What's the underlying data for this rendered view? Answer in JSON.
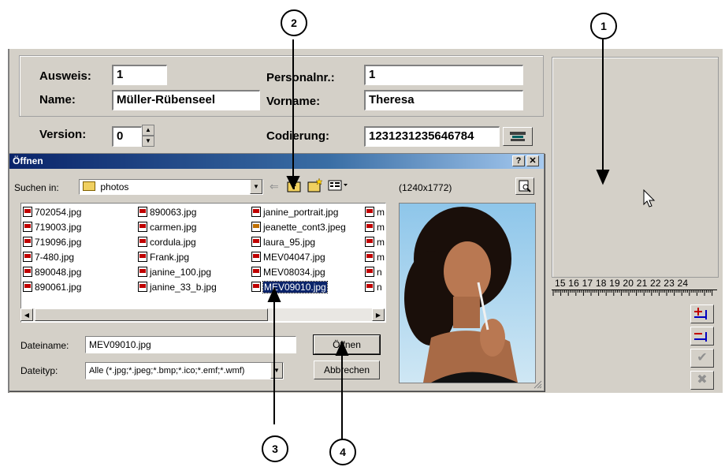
{
  "form": {
    "ausweis_label": "Ausweis:",
    "ausweis_value": "1",
    "name_label": "Name:",
    "name_value": "Müller-Rübenseel",
    "personalnr_label": "Personalnr.:",
    "personalnr_value": "1",
    "vorname_label": "Vorname:",
    "vorname_value": "Theresa",
    "version_label": "Version:",
    "version_value": "0",
    "codierung_label": "Codierung:",
    "codierung_value": "1231231235646784"
  },
  "ruler": {
    "numbers": "15 16 17 18 19 20 21 22 23 24"
  },
  "dialog": {
    "title": "Öffnen",
    "help_button": "?",
    "close_button": "✕",
    "lookin_label": "Suchen in:",
    "lookin_value": "photos",
    "image_size": "(1240x1772)",
    "files": [
      [
        "702054.jpg",
        "719003.jpg",
        "719096.jpg",
        "7-480.jpg",
        "890048.jpg",
        "890061.jpg"
      ],
      [
        "890063.jpg",
        "carmen.jpg",
        "cordula.jpg",
        "Frank.jpg",
        "janine_100.jpg",
        "janine_33_b.jpg"
      ],
      [
        "janine_portrait.jpg",
        "jeanette_cont3.jpeg",
        "laura_95.jpg",
        "MEV04047.jpg",
        "MEV08034.jpg",
        "MEV09010.jpg"
      ],
      [
        "m",
        "m",
        "m",
        "m",
        "n",
        "n"
      ]
    ],
    "selected_file": "MEV09010.jpg",
    "filename_label": "Dateiname:",
    "filename_value": "MEV09010.jpg",
    "filetype_label": "Dateityp:",
    "filetype_value": "Alle (*.jpg;*.jpeg;*.bmp;*.ico;*.emf;*.wmf)",
    "open_button": "Öffnen",
    "cancel_button": "Abbrechen"
  },
  "callouts": [
    "1",
    "2",
    "3",
    "4"
  ]
}
